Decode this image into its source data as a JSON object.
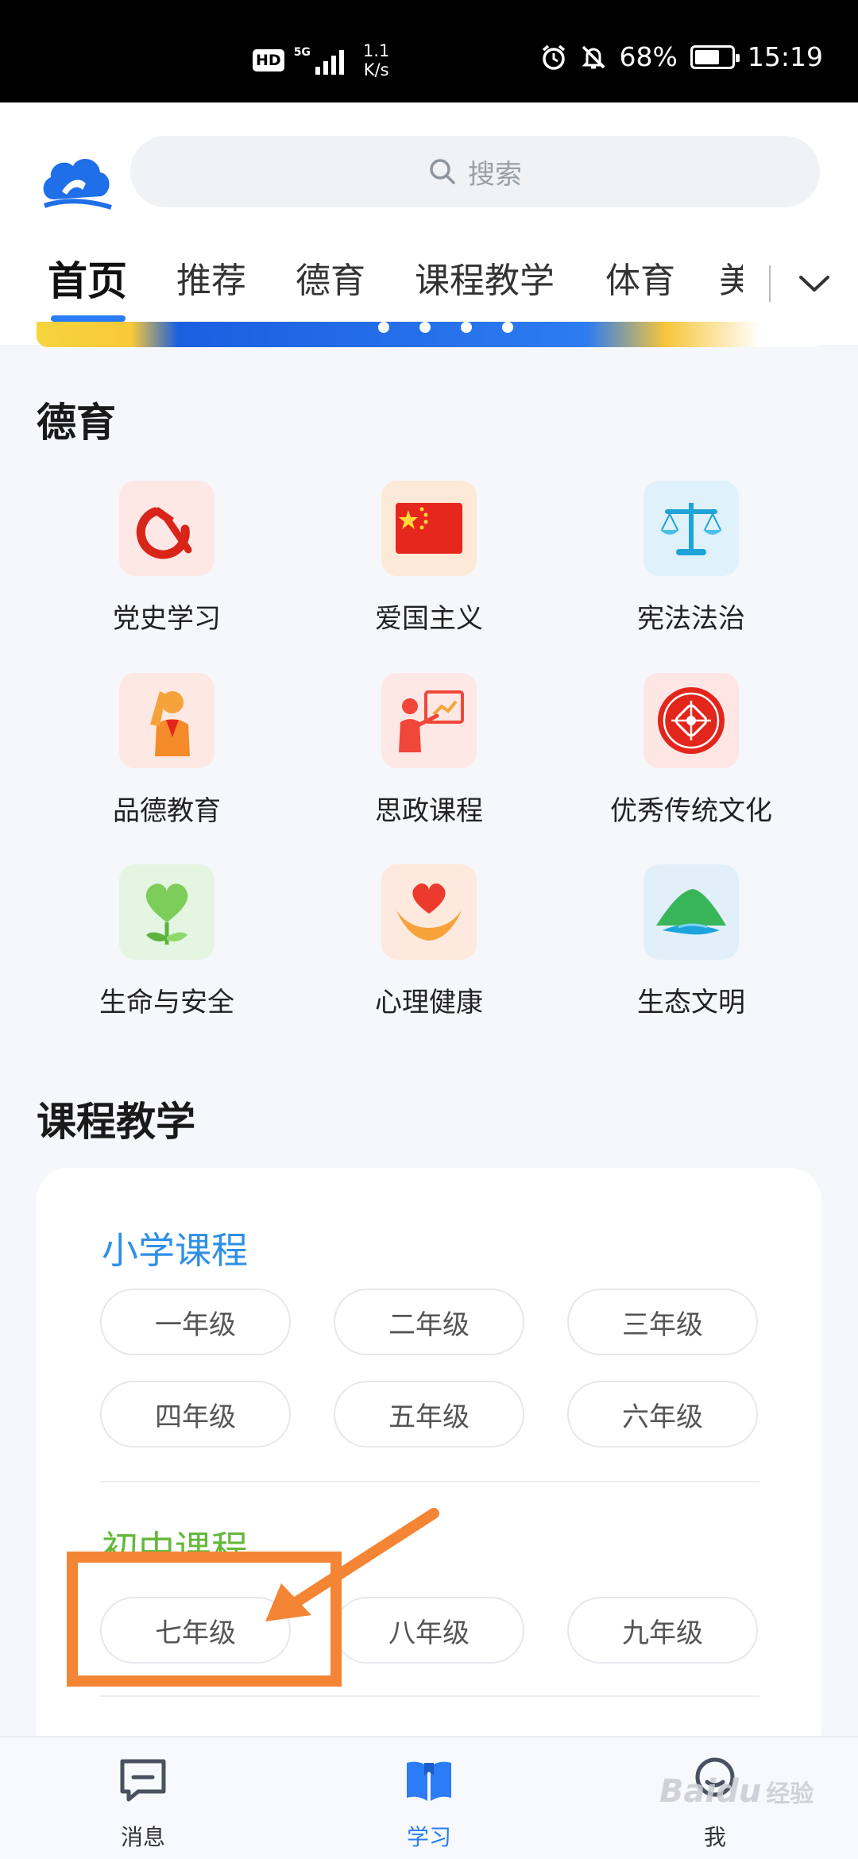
{
  "status_bar": {
    "hd": "HD",
    "network": "5G",
    "speed_value": "1.1",
    "speed_unit": "K/s",
    "battery": "68%",
    "battery_level": 0.68,
    "time": "15:19"
  },
  "header": {
    "search_placeholder": "搜索",
    "tabs": [
      "首页",
      "推荐",
      "德育",
      "课程教学",
      "体育",
      "美"
    ],
    "active_tab": "首页"
  },
  "moral": {
    "title": "德育",
    "items": [
      {
        "label": "党史学习",
        "icon": "hammer-sickle-icon"
      },
      {
        "label": "爱国主义",
        "icon": "national-flag-icon"
      },
      {
        "label": "宪法法治",
        "icon": "scales-icon"
      },
      {
        "label": "品德教育",
        "icon": "young-pioneer-salute-icon"
      },
      {
        "label": "思政课程",
        "icon": "teacher-board-icon"
      },
      {
        "label": "优秀传统文化",
        "icon": "chinese-knot-icon"
      },
      {
        "label": "生命与安全",
        "icon": "heart-sprout-icon"
      },
      {
        "label": "心理健康",
        "icon": "heart-hands-icon"
      },
      {
        "label": "生态文明",
        "icon": "green-mountain-icon"
      }
    ]
  },
  "courses": {
    "title": "课程教学",
    "primary": {
      "title": "小学课程",
      "color": "#2f8fe6",
      "grades": [
        "一年级",
        "二年级",
        "三年级",
        "四年级",
        "五年级",
        "六年级"
      ]
    },
    "junior": {
      "title": "初中课程",
      "color": "#63b83a",
      "grades": [
        "七年级",
        "八年级",
        "九年级"
      ]
    }
  },
  "bottom_nav": [
    {
      "label": "消息",
      "icon": "message-icon"
    },
    {
      "label": "学习",
      "icon": "book-icon",
      "active": true
    },
    {
      "label": "我",
      "icon": "profile-icon"
    }
  ],
  "watermark": {
    "brand": "Baidu",
    "suffix": "经验"
  },
  "colors": {
    "accent": "#2b7cf6",
    "annotation": "#f48534"
  }
}
